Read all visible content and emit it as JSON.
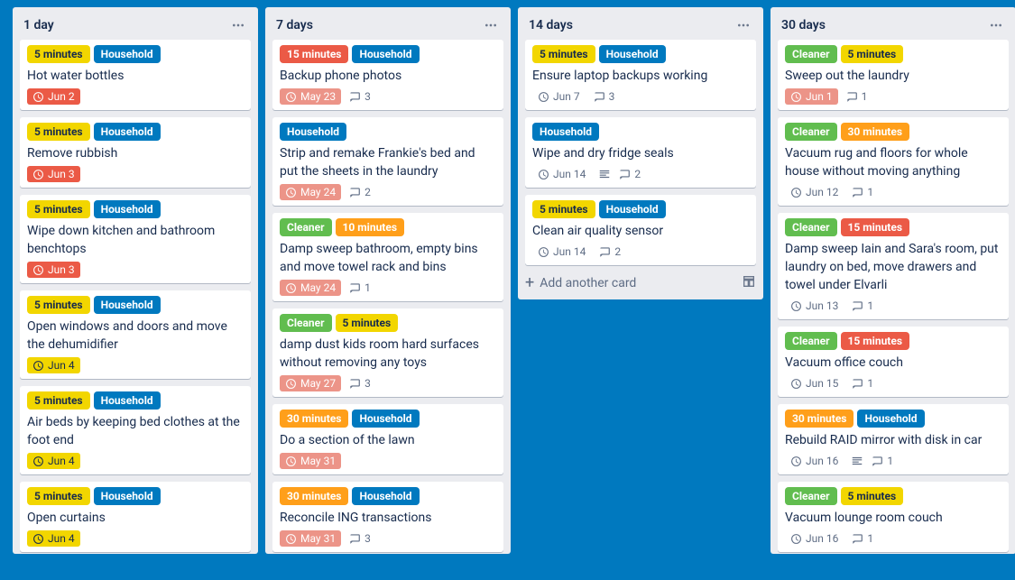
{
  "labels": {
    "5min": {
      "text": "5 minutes",
      "color": "yellow"
    },
    "10min": {
      "text": "10 minutes",
      "color": "orange"
    },
    "15min": {
      "text": "15 minutes",
      "color": "red"
    },
    "15minR": {
      "text": "15 minutes",
      "color": "red"
    },
    "30min": {
      "text": "30 minutes",
      "color": "orange"
    },
    "household": {
      "text": "Household",
      "color": "blue"
    },
    "cleaner": {
      "text": "Cleaner",
      "color": "green"
    }
  },
  "add_card_label": "Add another card",
  "lists": [
    {
      "title": "1 day",
      "cards": [
        {
          "labels": [
            "5min",
            "household"
          ],
          "title": "Hot water bottles",
          "due": "Jun 2",
          "dueState": "overdue-red"
        },
        {
          "labels": [
            "5min",
            "household"
          ],
          "title": "Remove rubbish",
          "due": "Jun 3",
          "dueState": "overdue-red"
        },
        {
          "labels": [
            "5min",
            "household"
          ],
          "title": "Wipe down kitchen and bathroom benchtops",
          "due": "Jun 3",
          "dueState": "overdue-red"
        },
        {
          "labels": [
            "5min",
            "household"
          ],
          "title": "Open windows and doors and move the dehumidifier",
          "due": "Jun 4",
          "dueState": "upcoming"
        },
        {
          "labels": [
            "5min",
            "household"
          ],
          "title": "Air beds by keeping bed clothes at the foot end",
          "due": "Jun 4",
          "dueState": "upcoming"
        },
        {
          "labels": [
            "5min",
            "household"
          ],
          "title": "Open curtains",
          "due": "Jun 4",
          "dueState": "upcoming"
        }
      ]
    },
    {
      "title": "7 days",
      "cards": [
        {
          "labels": [
            "15min",
            "household"
          ],
          "title": "Backup phone photos",
          "due": "May 23",
          "dueState": "overdue-pink",
          "comments": 3
        },
        {
          "labels": [
            "household"
          ],
          "title": "Strip and remake Frankie's bed and put the sheets in the laundry",
          "due": "May 24",
          "dueState": "overdue-pink",
          "comments": 2
        },
        {
          "labels": [
            "cleaner",
            "10min"
          ],
          "title": "Damp sweep bathroom, empty bins and move towel rack and bins",
          "due": "May 24",
          "dueState": "overdue-pink",
          "comments": 1
        },
        {
          "labels": [
            "cleaner",
            "5min"
          ],
          "title": "damp dust kids room hard surfaces without removing any toys",
          "due": "May 27",
          "dueState": "overdue-pink",
          "comments": 3
        },
        {
          "labels": [
            "30min",
            "household"
          ],
          "title": "Do a section of the lawn",
          "due": "May 31",
          "dueState": "overdue-pink"
        },
        {
          "labels": [
            "30min",
            "household"
          ],
          "title": "Reconcile ING transactions",
          "due": "May 31",
          "dueState": "overdue-pink",
          "comments": 3
        }
      ]
    },
    {
      "title": "14 days",
      "add_visible": true,
      "cards": [
        {
          "labels": [
            "5min",
            "household"
          ],
          "title": "Ensure laptop backups working",
          "due": "Jun 7",
          "dueState": "none",
          "comments": 3
        },
        {
          "labels": [
            "household"
          ],
          "title": "Wipe and dry fridge seals",
          "due": "Jun 14",
          "dueState": "none",
          "desc": true,
          "comments": 2
        },
        {
          "labels": [
            "5min",
            "household"
          ],
          "title": "Clean air quality sensor",
          "due": "Jun 14",
          "dueState": "none",
          "comments": 2
        }
      ]
    },
    {
      "title": "30 days",
      "cards": [
        {
          "labels": [
            "cleaner",
            "5min"
          ],
          "title": "Sweep out the laundry",
          "due": "Jun 1",
          "dueState": "overdue-pink",
          "comments": 1
        },
        {
          "labels": [
            "cleaner",
            "30min"
          ],
          "title": "Vacuum rug and floors for whole house without moving anything",
          "due": "Jun 12",
          "dueState": "none",
          "comments": 1
        },
        {
          "labels": [
            "cleaner",
            "15minR"
          ],
          "title": "Damp sweep Iain and Sara's room, put laundry on bed, move drawers and towel under Elvarli",
          "due": "Jun 13",
          "dueState": "none",
          "comments": 1
        },
        {
          "labels": [
            "cleaner",
            "15minR"
          ],
          "title": "Vacuum office couch",
          "due": "Jun 15",
          "dueState": "none",
          "comments": 1
        },
        {
          "labels": [
            "30min",
            "household"
          ],
          "title": "Rebuild RAID mirror with disk in car",
          "due": "Jun 16",
          "dueState": "none",
          "desc": true,
          "comments": 1
        },
        {
          "labels": [
            "cleaner",
            "5min"
          ],
          "title": "Vacuum lounge room couch",
          "due": "Jun 16",
          "dueState": "none",
          "comments": 1
        }
      ]
    }
  ]
}
